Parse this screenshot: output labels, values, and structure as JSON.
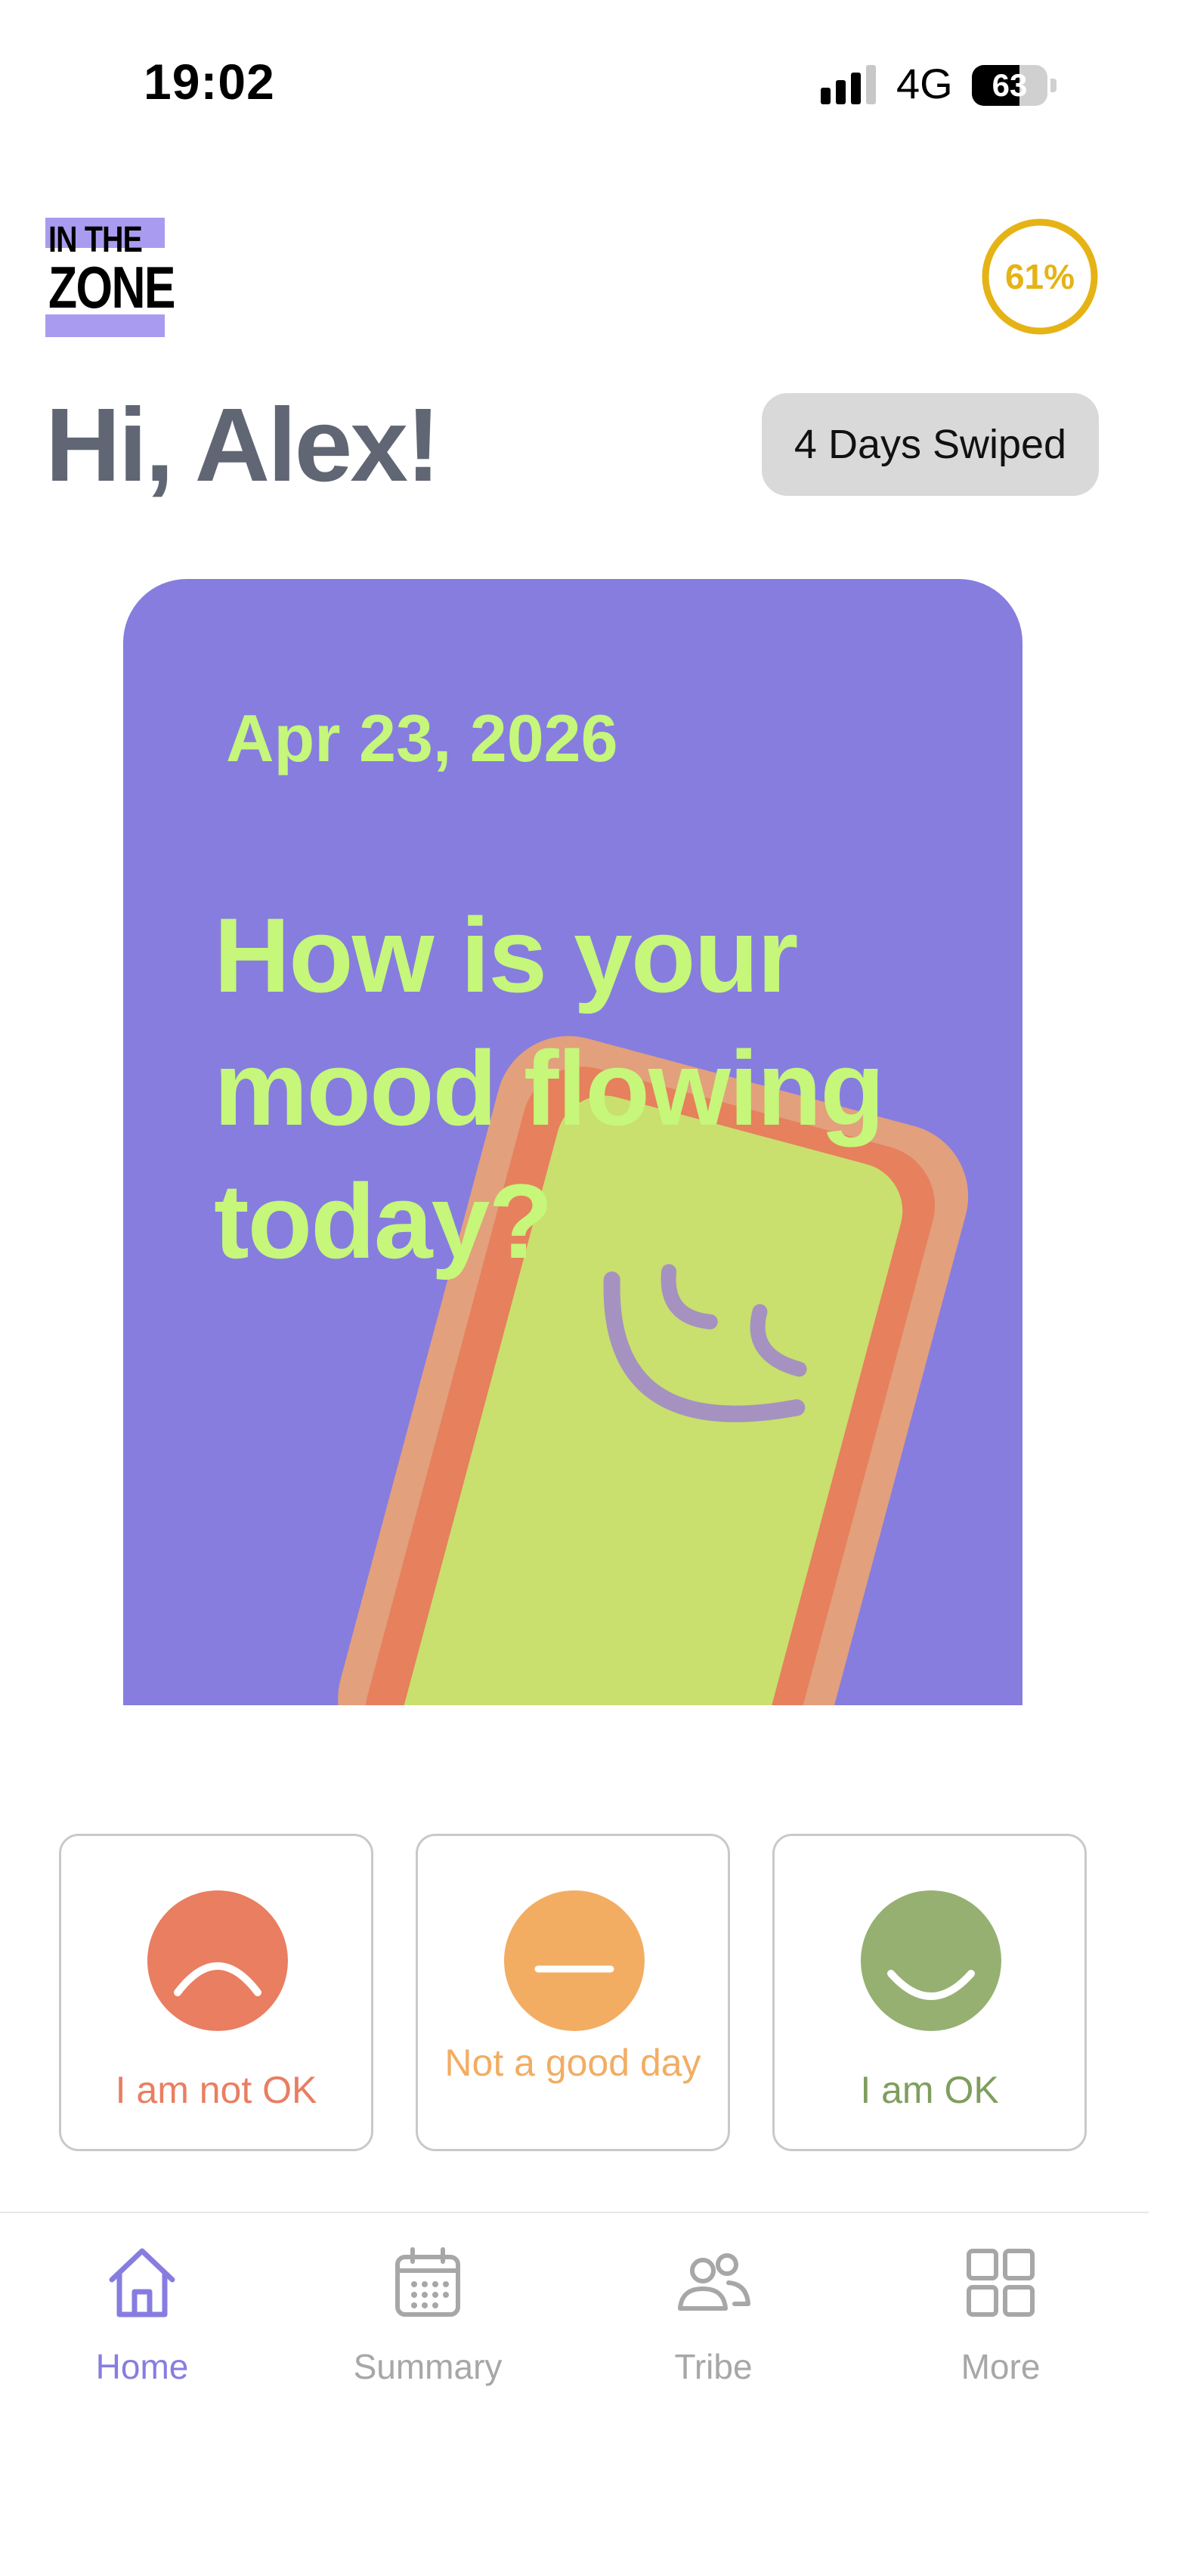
{
  "status_bar": {
    "time": "19:02",
    "network": "4G",
    "battery_level": "63",
    "battery_fraction": 0.63,
    "icons": [
      "signal-icon",
      "battery-icon"
    ]
  },
  "header": {
    "logo_line1": "IN THE",
    "logo_line2": "ZONE",
    "progress_percent_label": "61%",
    "progress_fraction": 0.61,
    "progress_color": "#e5b315",
    "greeting": "Hi, Alex!",
    "days_swiped": "4 Days Swiped"
  },
  "mood_card": {
    "date": "Apr 23, 2026",
    "question": "How is your mood flowing today?",
    "background_color": "#867ddf",
    "text_color": "#c6f67a"
  },
  "mood_options": [
    {
      "label": "I am not OK",
      "icon": "sad-face-icon",
      "color": "#e97e61"
    },
    {
      "label": "Not a good day",
      "icon": "neutral-face-icon",
      "color": "#f2ad63"
    },
    {
      "label": "I am OK",
      "icon": "happy-face-icon",
      "color": "#96b072"
    }
  ],
  "tab_bar": {
    "active_color": "#877de0",
    "tabs": [
      {
        "label": "Home",
        "icon": "home-icon",
        "active": true
      },
      {
        "label": "Summary",
        "icon": "calendar-icon",
        "active": false
      },
      {
        "label": "Tribe",
        "icon": "people-icon",
        "active": false
      },
      {
        "label": "More",
        "icon": "grid-icon",
        "active": false
      }
    ]
  }
}
